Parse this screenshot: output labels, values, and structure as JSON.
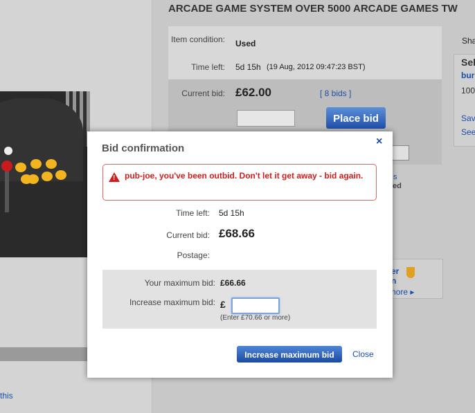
{
  "page": {
    "title": "ARCADE GAME SYSTEM OVER 5000 ARCADE GAMES TW",
    "share_label": "Sha",
    "item_condition_label": "Item condition:",
    "item_condition_value": "Used",
    "time_left_label": "Time left:",
    "time_left_value": "5d 15h",
    "time_left_date": "(19 Aug, 2012 09:47:23 BST)",
    "current_bid_label": "Current bid:",
    "current_bid_value": "£62.00",
    "bids_link": "[ 8 bids ]",
    "place_bid_label": "Place bid",
    "left_link": "this",
    "right_panel": [
      "Sel",
      "bur",
      "100",
      "Sav",
      "See"
    ],
    "fragments": [
      "s",
      "ed"
    ],
    "promo_lines": [
      "er",
      "n",
      "nore ▸"
    ]
  },
  "modal": {
    "title": "Bid confirmation",
    "close_x": "×",
    "alert_message": "pub-joe, you've been outbid. Don't let it get away - bid again.",
    "time_left_label": "Time left:",
    "time_left_value": "5d  15h",
    "current_bid_label": "Current bid:",
    "current_bid_value": "£68.66",
    "postage_label": "Postage:",
    "your_max_bid_label": "Your maximum bid:",
    "your_max_bid_value": "£66.66",
    "increase_max_bid_label": "Increase maximum bid:",
    "currency_symbol": "£",
    "max_bid_input_value": "",
    "hint": "(Enter £70.66 or more)",
    "increase_button_label": "Increase maximum bid",
    "close_link_label": "Close"
  },
  "colors": {
    "link": "#1b4ea8",
    "alert": "#d01d1d",
    "button": "#1f4fa8"
  }
}
